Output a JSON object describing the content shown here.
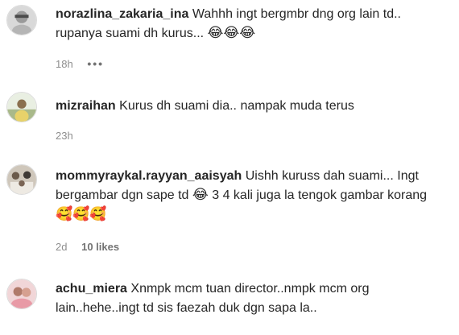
{
  "comments": [
    {
      "username": "norazlina_zakaria_ina",
      "text": "Wahhh ingt bergmbr dng org lain td.. rupanya suami dh kurus...",
      "emoji": "😂😂😂",
      "time": "18h",
      "more": "•••",
      "avatar_icon": "avatar-photo-icon"
    },
    {
      "username": "mizraihan",
      "text": "Kurus dh suami dia.. nampak muda terus",
      "time": "23h",
      "avatar_icon": "avatar-photo-icon"
    },
    {
      "username": "mommyraykal.rayyan_aaisyah",
      "text_a": "Uishh kuruss dah suami... Ingt bergambar dgn sape td",
      "emoji_a": "😂",
      "text_b": "3 4 kali juga la tengok gambar korang",
      "emoji_b": "🥰🥰🥰",
      "time": "2d",
      "likes": "10 likes",
      "avatar_icon": "avatar-photo-icon"
    },
    {
      "username": "achu_miera",
      "text": "Xnmpk mcm tuan director..nmpk mcm org lain..hehe..ingt td sis faezah duk dgn sapa la..",
      "avatar_icon": "avatar-photo-icon"
    }
  ],
  "colors": {
    "text": "#262626",
    "secondary": "#8e8e8e"
  }
}
